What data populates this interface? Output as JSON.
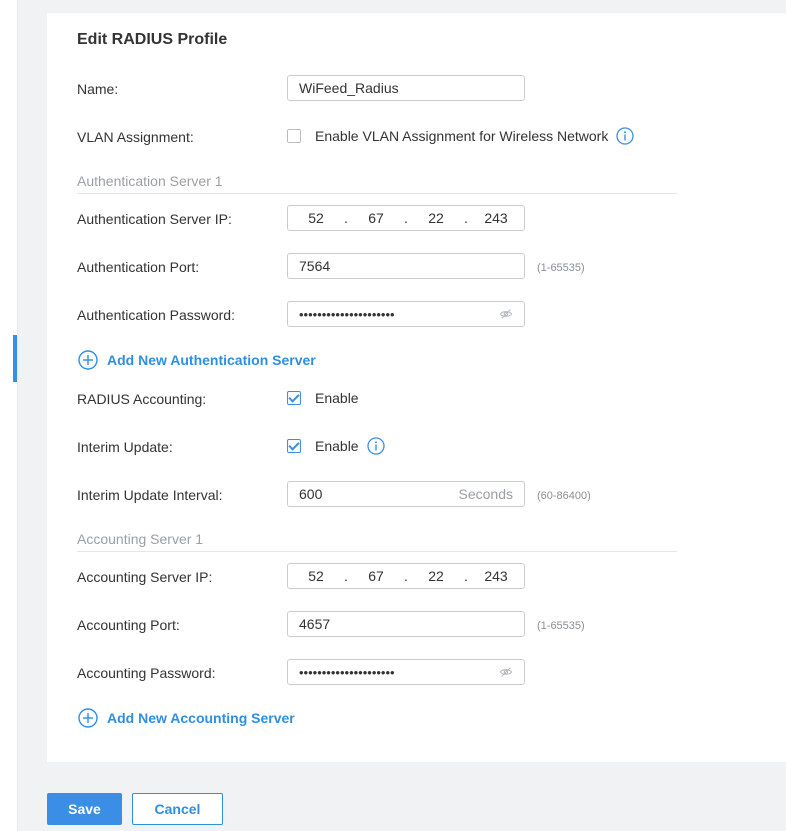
{
  "form": {
    "title": "Edit RADIUS Profile",
    "name_label": "Name:",
    "name_value": "WiFeed_Radius",
    "vlan_label": "VLAN Assignment:",
    "vlan_checkbox_label": "Enable VLAN Assignment for Wireless Network",
    "vlan_checked": false
  },
  "auth": {
    "section_title": "Authentication Server 1",
    "ip_label": "Authentication Server IP:",
    "ip": [
      "52",
      "67",
      "22",
      "243"
    ],
    "port_label": "Authentication Port:",
    "port_value": "7564",
    "port_hint": "(1-65535)",
    "password_label": "Authentication Password:",
    "password_mask": "•••••••••••••••••••••",
    "add_label": "Add New Authentication Server"
  },
  "accounting": {
    "radius_label": "RADIUS Accounting:",
    "radius_enable_label": "Enable",
    "radius_checked": true,
    "interim_label": "Interim Update:",
    "interim_enable_label": "Enable",
    "interim_checked": true,
    "interval_label": "Interim Update Interval:",
    "interval_value": "600",
    "interval_unit": "Seconds",
    "interval_hint": "(60-86400)",
    "section_title": "Accounting Server 1",
    "ip_label": "Accounting Server IP:",
    "ip": [
      "52",
      "67",
      "22",
      "243"
    ],
    "port_label": "Accounting Port:",
    "port_value": "4657",
    "port_hint": "(1-65535)",
    "password_label": "Accounting Password:",
    "password_mask": "•••••••••••••••••••••",
    "add_label": "Add New Accounting Server"
  },
  "actions": {
    "save_label": "Save",
    "cancel_label": "Cancel"
  },
  "colors": {
    "accent": "#3a8ee6",
    "link": "#2e8fe0",
    "background": "#f1f2f4",
    "panel": "#ffffff"
  }
}
